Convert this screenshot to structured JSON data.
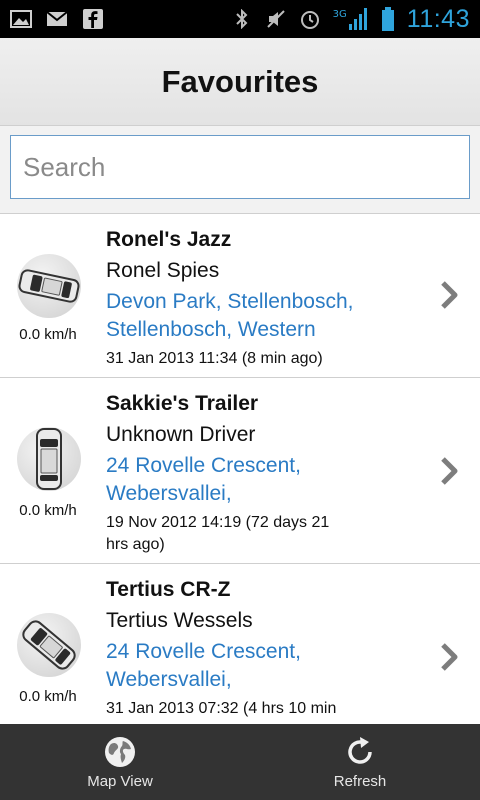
{
  "status_bar": {
    "time": "11:43",
    "network_label": "3G",
    "icons_left": [
      "picture-icon",
      "gmail-icon",
      "facebook-icon"
    ],
    "icons_right": [
      "bluetooth-icon",
      "mute-icon",
      "alarm-icon",
      "signal-icon",
      "battery-icon"
    ]
  },
  "header": {
    "title": "Favourites"
  },
  "search": {
    "placeholder": "Search",
    "value": ""
  },
  "vehicles": [
    {
      "name": "Ronel's Jazz",
      "driver": "Ronel Spies",
      "address_line1": "Devon Park, Stellenbosch,",
      "address_line2": "Stellenbosch, Western",
      "time_line1": "31 Jan 2013 11:34 (8 min ago)",
      "time_line2": "",
      "speed": "0.0 km/h"
    },
    {
      "name": "Sakkie's Trailer",
      "driver": "Unknown Driver",
      "address_line1": "24 Rovelle Crescent,",
      "address_line2": "Webersvallei,",
      "time_line1": "19 Nov 2012 14:19 (72 days 21",
      "time_line2": "hrs  ago)",
      "speed": "0.0 km/h"
    },
    {
      "name": "Tertius CR-Z",
      "driver": "Tertius Wessels",
      "address_line1": "24 Rovelle Crescent,",
      "address_line2": "Webersvallei,",
      "time_line1": "31 Jan 2013 07:32 (4 hrs 10 min",
      "time_line2": "",
      "speed": "0.0 km/h"
    }
  ],
  "bottom_bar": {
    "map_view_label": "Map View",
    "refresh_label": "Refresh"
  },
  "colors": {
    "accent": "#2fa4dc",
    "address": "#2a7bc4",
    "bottom_bar": "#333333"
  }
}
